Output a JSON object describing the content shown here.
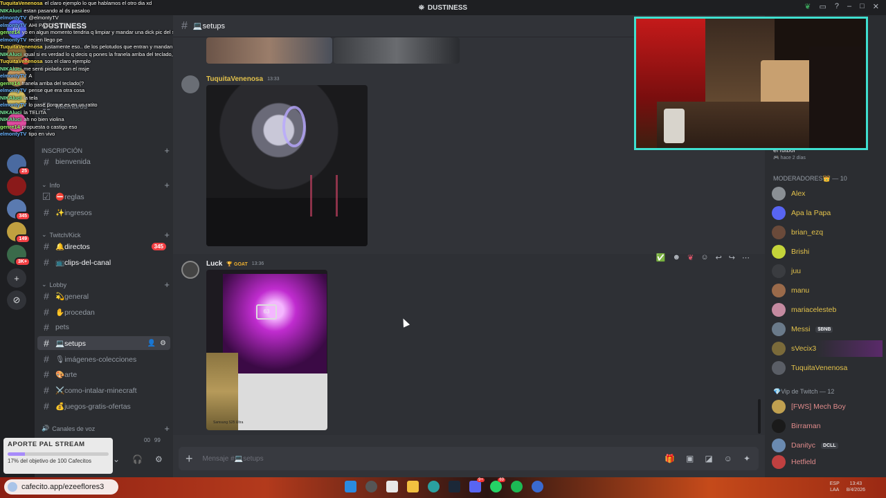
{
  "window": {
    "title": "DUSTINESS"
  },
  "server": {
    "name": "DUSTINESS"
  },
  "server_rail": [
    {
      "icon": "discord-icon",
      "badge": ""
    },
    {
      "icon": "server-avatar",
      "badge": "3"
    },
    {
      "icon": "server-avatar",
      "badge": ""
    },
    {
      "icon": "server-avatar",
      "badge": ""
    },
    {
      "icon": "server-avatar",
      "badge": "25"
    },
    {
      "icon": "server-avatar",
      "badge": ""
    },
    {
      "icon": "server-avatar",
      "badge": "345"
    },
    {
      "icon": "server-avatar",
      "badge": "149"
    },
    {
      "icon": "server-avatar",
      "badge": "3K+"
    },
    {
      "icon": "add-server-icon",
      "badge": ""
    },
    {
      "icon": "explore-icon",
      "badge": ""
    }
  ],
  "sidebar": {
    "misc": {
      "members": "Miembros",
      "events": "INSCRIPCIÓN",
      "bienvenida": "bienvenida"
    },
    "categories": [
      {
        "label": "Info"
      },
      {
        "label": "Twitch/Kick"
      },
      {
        "label": "Lobby"
      },
      {
        "label": "Canales de voz"
      }
    ],
    "channels": [
      {
        "label": "⛔reglas"
      },
      {
        "label": "✨ingresos"
      },
      {
        "label": "🔔directos",
        "badge": "345"
      },
      {
        "label": "📺clips-del-canal"
      },
      {
        "label": "💫general"
      },
      {
        "label": "✋procedan"
      },
      {
        "label": "pets"
      },
      {
        "label": "💻setups"
      },
      {
        "label": "🎙imágenes-colecciones"
      },
      {
        "label": "🎨arte"
      },
      {
        "label": "⚔️como-intalar-minecraft"
      },
      {
        "label": "💰juegos-gratis-ofertas"
      }
    ]
  },
  "main": {
    "channel_name": "💻setups",
    "messages": [
      {
        "author": "TuquitaVenenosa",
        "time": "13:33"
      },
      {
        "author": "Luck",
        "badge": "GOAT",
        "time": "13:36",
        "caption": "Samsung S25 Ultra"
      }
    ],
    "composer_placeholder": "Mensaje #💻setups"
  },
  "members": {
    "lists": [
      {
        "title": "MODERADORES👑 — 10",
        "items": [
          {
            "name": "Alex",
            "tag": ""
          },
          {
            "name": "Apa la Papa",
            "tag": ""
          },
          {
            "name": "brian_ezq",
            "tag": ""
          },
          {
            "name": "Brishi",
            "tag": ""
          },
          {
            "name": "juu",
            "tag": ""
          },
          {
            "name": "manu",
            "tag": ""
          },
          {
            "name": "mariacelesteb",
            "tag": ""
          },
          {
            "name": "Messi",
            "tag": "$BNB"
          },
          {
            "name": "sVecix3",
            "tag": ""
          },
          {
            "name": "TuquitaVenenosa",
            "tag": ""
          }
        ]
      },
      {
        "title": "💎Vip de Twitch — 12",
        "items": [
          {
            "name": "[FWS] Mech Boy",
            "tag": ""
          },
          {
            "name": "Birraman",
            "tag": ""
          },
          {
            "name": "Danityc",
            "tag": "DCLL"
          },
          {
            "name": "Hetfield",
            "tag": ""
          }
        ]
      }
    ],
    "top_text": "hace 2 días",
    "top_name": "el futbol"
  },
  "stream_chat": [
    {
      "user": "TuquitaVenenosa",
      "text": "el claro ejemplo lo que hablamos el otro dia xd"
    },
    {
      "user": "NIKAluci",
      "text": "estan pasando al ds pasaloo"
    },
    {
      "user": "elmontyTV",
      "text": "@elmontyTV"
    },
    {
      "user": "elmontyTV",
      "text": "AHI PASO"
    },
    {
      "user": "genre14",
      "text": "yo en algun momento tendria q limpiar y mandar una dick pic del set ap como ta ahora xq ta rico"
    },
    {
      "user": "elmontyTV",
      "text": "recien llego pe"
    },
    {
      "user": "TuquitaVenenosa",
      "text": "justamente eso.. de los pelotudos que entran y mandan link sin contexto de lo que estamos hablando"
    },
    {
      "user": "NIKAluci",
      "text": "igual si es verdad lo q decis q pones la franela arriba del teclado, te creo q este limpio pq yo a la pc le hacia mantenimiento de mugre a cada rato"
    },
    {
      "user": "TuquitaVenenosa",
      "text": "sos el claro ejemplo"
    },
    {
      "user": "NIKAluci",
      "text": "me senti piolada con el msje"
    },
    {
      "user": "elmontyTV",
      "text": "A"
    },
    {
      "user": "genre14",
      "text": "franela arriba del teclado(?"
    },
    {
      "user": "elmontyTV",
      "text": "pense que era otra cosa"
    },
    {
      "user": "NIKAluci",
      "text": "la tela"
    },
    {
      "user": "elmontyTV",
      "text": "lo pase porque es en un ratito"
    },
    {
      "user": "NIKAluci",
      "text": "la TELITA"
    },
    {
      "user": "NIKAluci",
      "text": "ah no bien violina"
    },
    {
      "user": "genre14",
      "text": "propuesta o castigo eso"
    },
    {
      "user": "elmontyTV",
      "text": "tipo en vivo"
    }
  ],
  "support_widget": {
    "title": "APORTE PAL STREAM",
    "progress_percent": 17,
    "subtitle": "17% del objetivo de 100 Cafecitos"
  },
  "userpanel": {
    "counter_a": "00",
    "counter_b": "99"
  },
  "taskbar": {
    "url": "cafecito.app/ezeeflores3",
    "whatsapp_badge": "69",
    "discord_badge": "9+",
    "lang": "ESP",
    "region": "LAA",
    "time": "13:43",
    "date": "8/4/2026"
  },
  "colors": {
    "accent_teal": "#3fe0d0",
    "mod_name": "#e3c24b",
    "vip_name": "#e08b8b",
    "badge_red": "#f23f43"
  }
}
